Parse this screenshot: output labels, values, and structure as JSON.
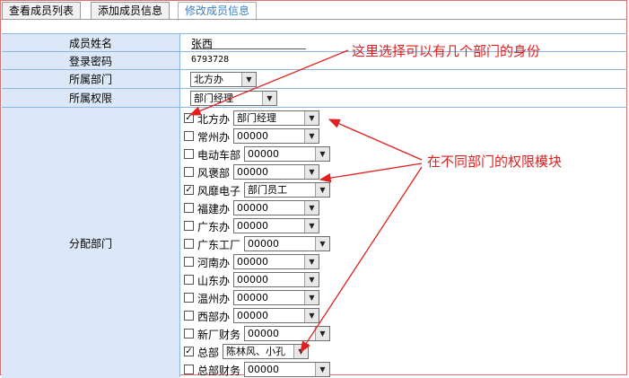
{
  "tabs": [
    {
      "label": "查看成员列表"
    },
    {
      "label": "添加成员信息"
    },
    {
      "label": "修改成员信息"
    }
  ],
  "form": {
    "name_label": "成员姓名",
    "name_value": "张西",
    "password_label": "登录密码",
    "password_value": "6793728",
    "dept_label": "所属部门",
    "dept_value": "北方办",
    "perm_label": "所属权限",
    "perm_value": "部门经理",
    "assign_label": "分配部门"
  },
  "departments": [
    {
      "name": "北方办",
      "checked": true,
      "role": "部门经理"
    },
    {
      "name": "常州办",
      "checked": false,
      "role": "00000"
    },
    {
      "name": "电动车部",
      "checked": false,
      "role": "00000"
    },
    {
      "name": "风褒部",
      "checked": false,
      "role": "00000"
    },
    {
      "name": "风靡电子",
      "checked": true,
      "role": "部门员工"
    },
    {
      "name": "福建办",
      "checked": false,
      "role": "00000"
    },
    {
      "name": "广东办",
      "checked": false,
      "role": "00000"
    },
    {
      "name": "广东工厂",
      "checked": false,
      "role": "00000"
    },
    {
      "name": "河南办",
      "checked": false,
      "role": "00000"
    },
    {
      "name": "山东办",
      "checked": false,
      "role": "00000"
    },
    {
      "name": "温州办",
      "checked": false,
      "role": "00000"
    },
    {
      "name": "西部办",
      "checked": false,
      "role": "00000"
    },
    {
      "name": "新厂财务",
      "checked": false,
      "role": "00000"
    },
    {
      "name": "总部",
      "checked": true,
      "role": "陈林风、小孔"
    },
    {
      "name": "总部财务",
      "checked": false,
      "role": "00000"
    }
  ],
  "annotations": {
    "top": "这里选择可以有几个部门的身份",
    "middle": "在不同部门的权限模块"
  },
  "colors": {
    "label_bg": "#dce8f7",
    "grid": "#8ab6e6",
    "annotation": "#e02020",
    "frame": "#e07070"
  }
}
